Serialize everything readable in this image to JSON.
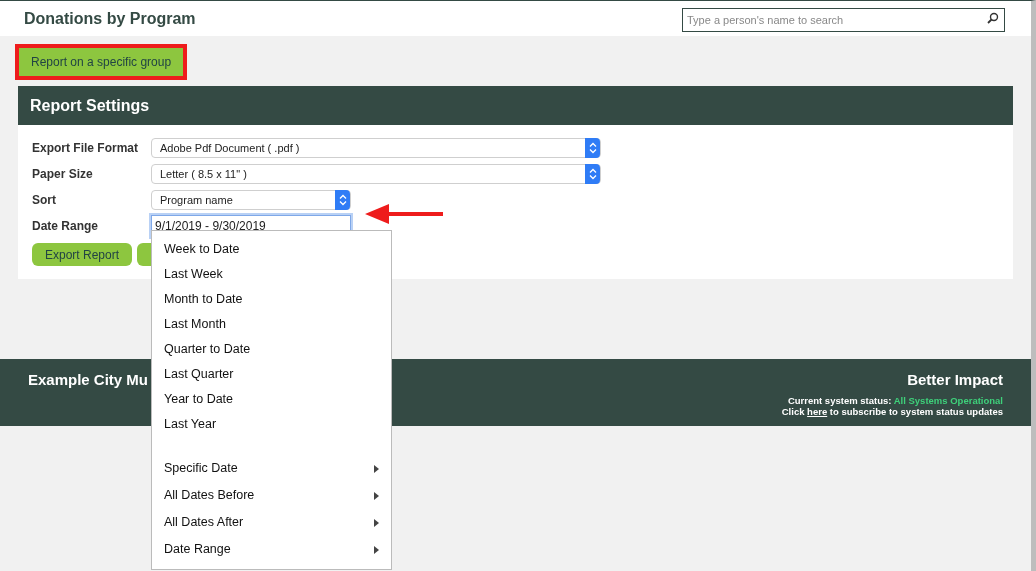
{
  "header": {
    "title": "Donations by Program",
    "search": {
      "placeholder": "Type a person's name to search"
    }
  },
  "group_button": {
    "label": "Report on a specific group",
    "highlighted": true
  },
  "report_settings": {
    "title": "Report Settings",
    "fields": [
      {
        "label": "Export File Format",
        "kind": "select",
        "value": "Adobe Pdf Document ( .pdf )"
      },
      {
        "label": "Paper Size",
        "kind": "select",
        "value": "Letter ( 8.5 x 11\" )"
      },
      {
        "label": "Sort",
        "kind": "select",
        "value": "Program name"
      },
      {
        "label": "Date Range",
        "kind": "input",
        "value": "9/1/2019 - 9/30/2019",
        "focused": true
      }
    ],
    "buttons": [
      {
        "kind": "labeled",
        "label": "Export Report"
      },
      {
        "kind": "covered"
      }
    ]
  },
  "annotation_arrow": true,
  "date_menu": [
    {
      "label": "Week to Date",
      "kind": "option"
    },
    {
      "label": "Last Week",
      "kind": "option"
    },
    {
      "label": "Month to Date",
      "kind": "option"
    },
    {
      "label": "Last Month",
      "kind": "option"
    },
    {
      "label": "Quarter to Date",
      "kind": "option"
    },
    {
      "label": "Last Quarter",
      "kind": "option"
    },
    {
      "label": "Year to Date",
      "kind": "option"
    },
    {
      "label": "Last Year",
      "kind": "option"
    },
    {
      "label": "Specific Date",
      "kind": "submenu"
    },
    {
      "label": "All Dates Before",
      "kind": "submenu"
    },
    {
      "label": "All Dates After",
      "kind": "submenu"
    },
    {
      "label": "Date Range",
      "kind": "submenu"
    }
  ],
  "footer": {
    "organization": "Example City Mu",
    "brand": "Better Impact",
    "status_label": "Current system status:",
    "status_value": "All Systems Operational",
    "subscribe_before": "Click",
    "subscribe_link": "here",
    "subscribe_after": "to subscribe to system status updates"
  }
}
